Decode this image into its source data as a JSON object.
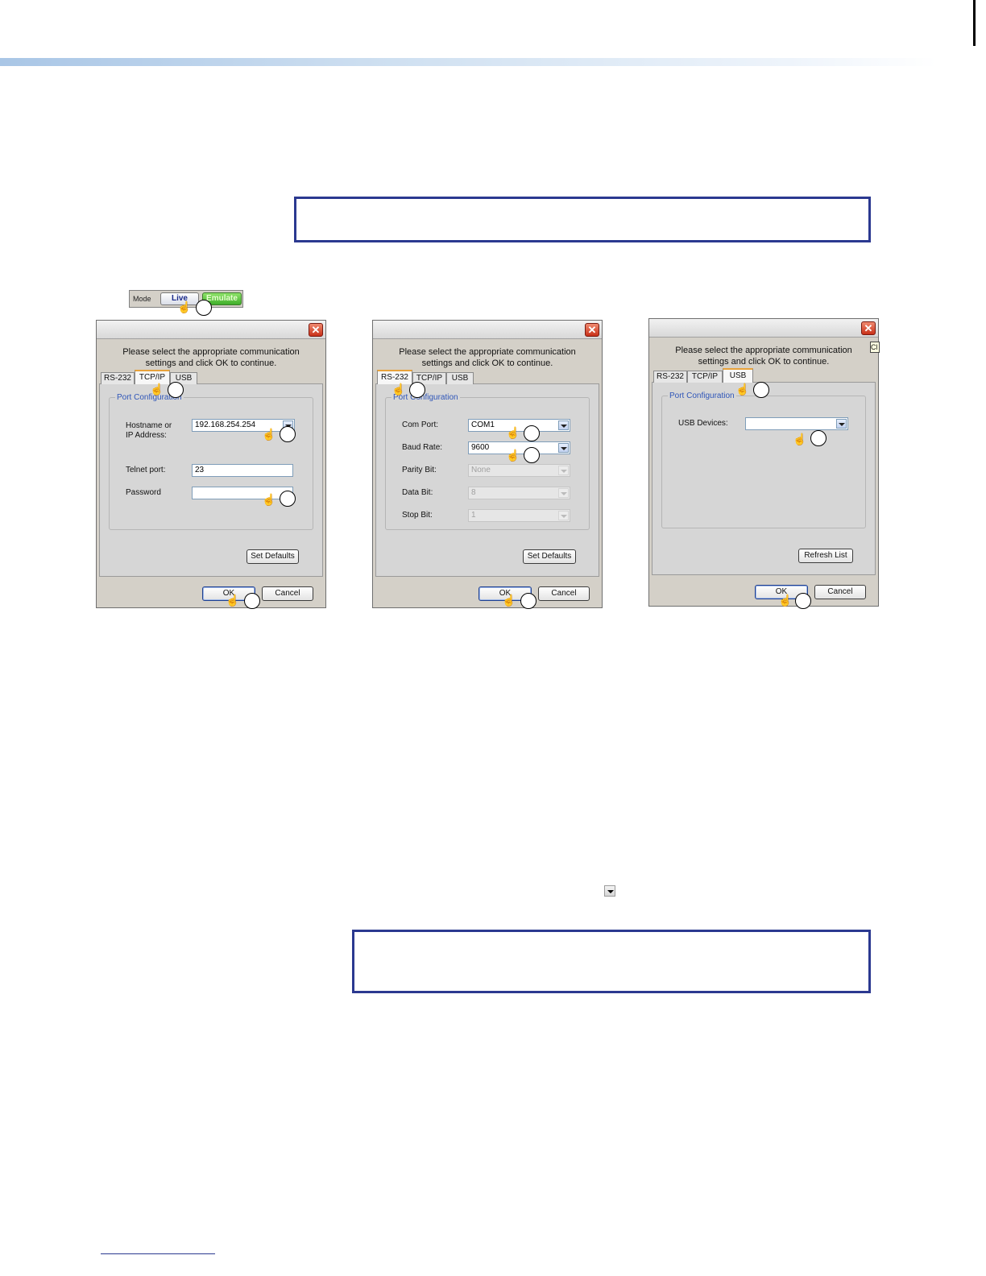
{
  "mode_bar": {
    "label": "Mode",
    "live_label": "Live",
    "emulate_label": "Emulate"
  },
  "prompt": {
    "line1": "Please select the appropriate communication",
    "line2": "settings and click OK to continue."
  },
  "tabs": {
    "rs232": "RS-232",
    "tcpip": "TCP/IP",
    "usb": "USB"
  },
  "group_title": "Port Configuration",
  "buttons": {
    "close": "✕",
    "ok": "OK",
    "cancel": "Cancel",
    "set_defaults": "Set Defaults",
    "refresh_list": "Refresh List"
  },
  "tcpip_dialog": {
    "hostname_label_line1": "Hostname or",
    "hostname_label_line2": "IP Address:",
    "hostname_value": "192.168.254.254",
    "telnet_label": "Telnet port:",
    "telnet_value": "23",
    "password_label": "Password",
    "password_value": ""
  },
  "rs232_dialog": {
    "com_port_label": "Com Port:",
    "com_port_value": "COM1",
    "baud_rate_label": "Baud Rate:",
    "baud_rate_value": "9600",
    "parity_bit_label": "Parity Bit:",
    "parity_bit_value": "None",
    "data_bit_label": "Data Bit:",
    "data_bit_value": "8",
    "stop_bit_label": "Stop Bit:",
    "stop_bit_value": "1"
  },
  "usb_dialog": {
    "devices_label": "USB Devices:",
    "devices_value": "",
    "tooltip_fragment": "Cl"
  },
  "icons": {
    "pointer": "☝"
  }
}
